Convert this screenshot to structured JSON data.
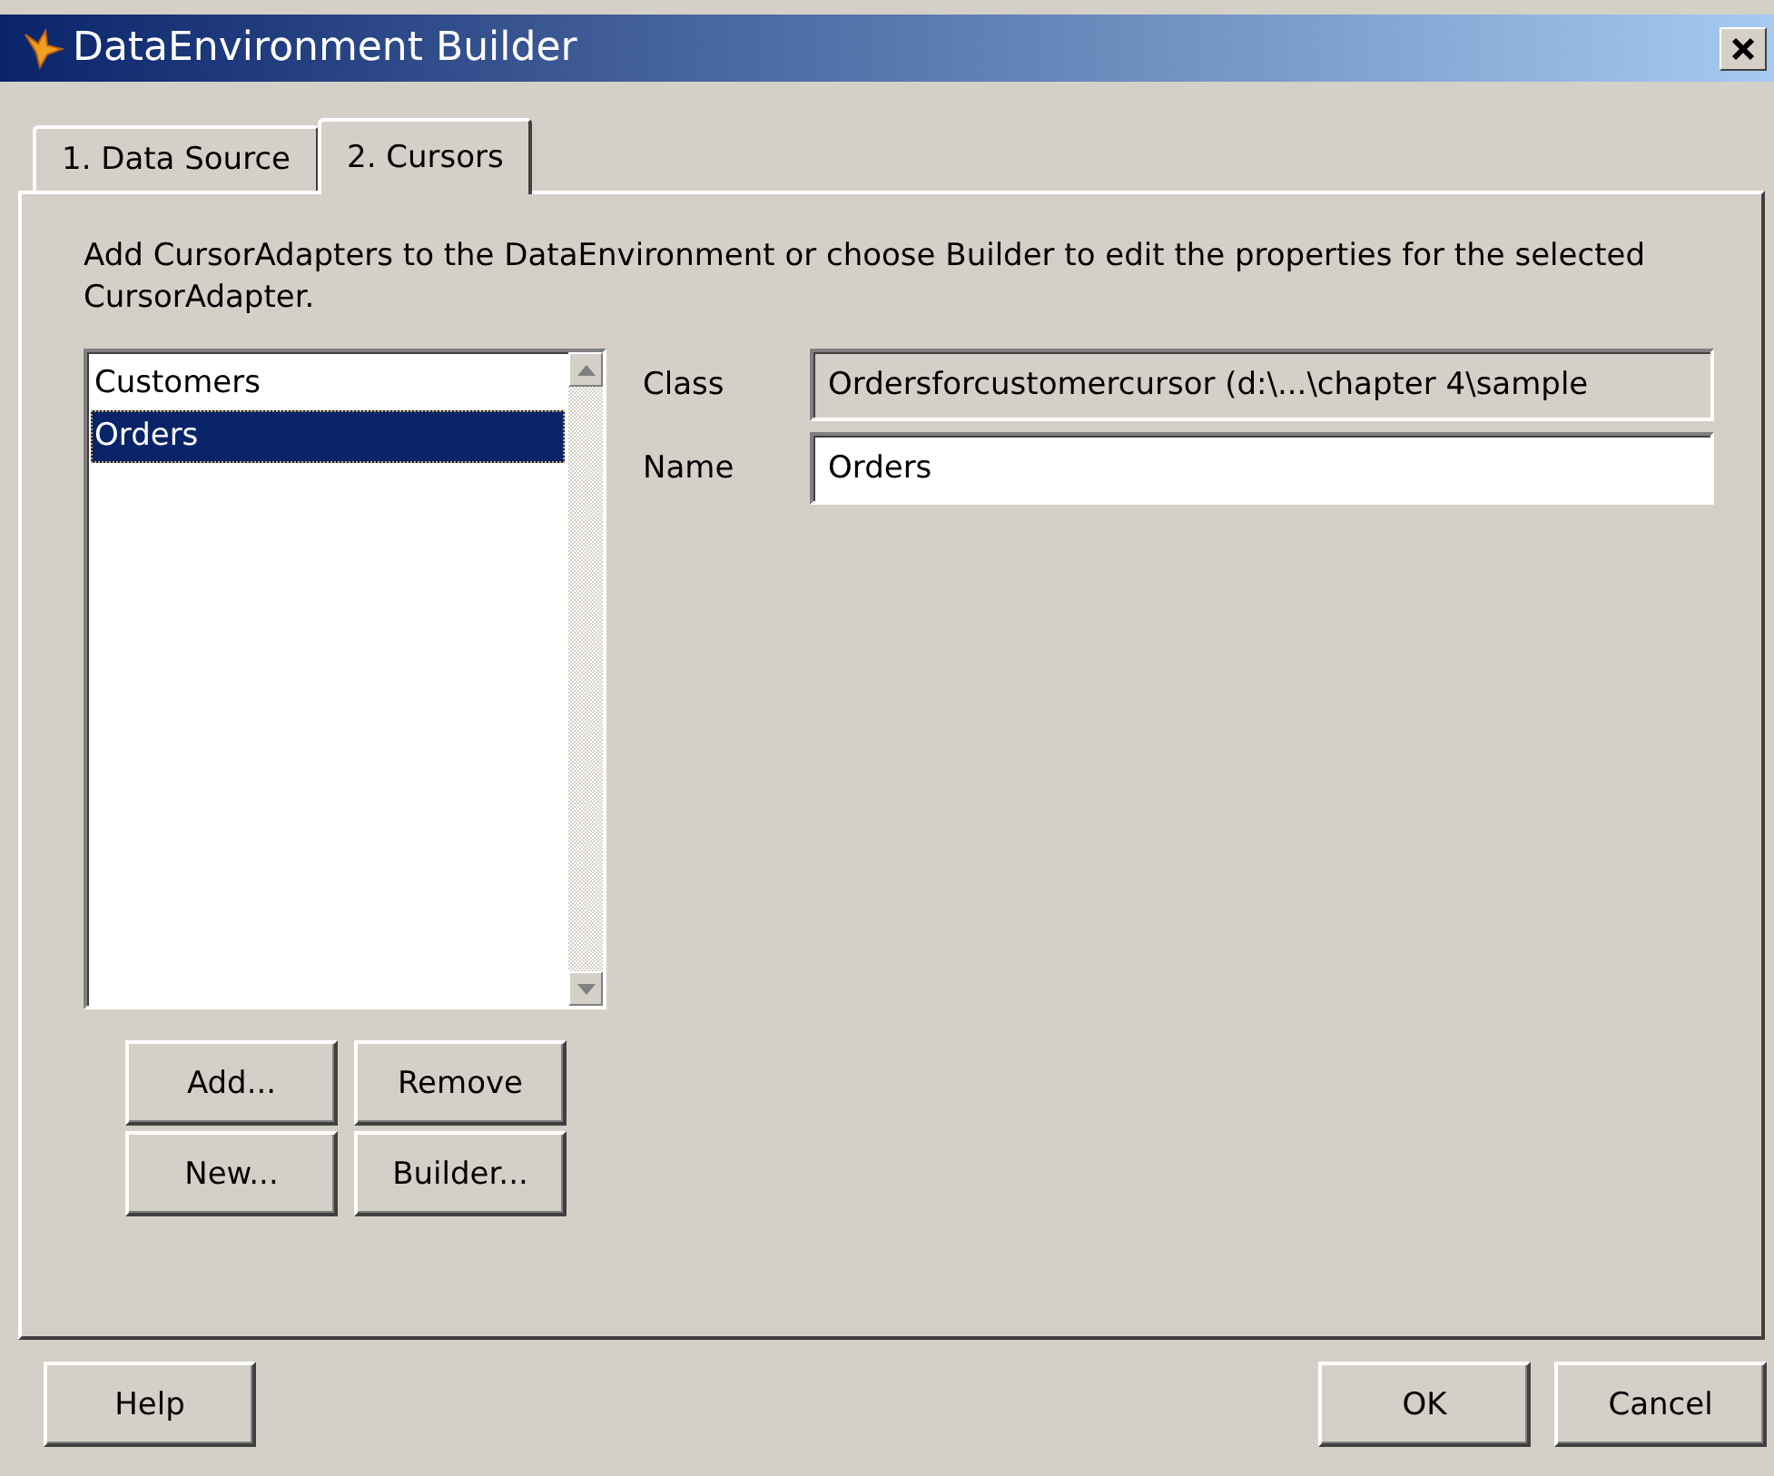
{
  "window": {
    "title": "DataEnvironment Builder"
  },
  "tabs": [
    {
      "label": "1. Data Source",
      "selected": false
    },
    {
      "label": "2. Cursors",
      "selected": true
    }
  ],
  "description": "Add CursorAdapters to the DataEnvironment or choose Builder to edit the properties for the selected CursorAdapter.",
  "cursor_list": {
    "items": [
      {
        "label": "Customers",
        "selected": false
      },
      {
        "label": "Orders",
        "selected": true
      }
    ]
  },
  "fields": [
    {
      "label": "Class",
      "value": "Ordersforcustomercursor (d:\\...\\chapter 4\\sample",
      "disabled": true
    },
    {
      "label": "Name",
      "value": "Orders",
      "disabled": false
    }
  ],
  "list_buttons": [
    "Add...",
    "Remove",
    "New...",
    "Builder..."
  ],
  "footer_left_buttons": [
    "Help"
  ],
  "footer_right_buttons": [
    "OK",
    "Cancel"
  ]
}
